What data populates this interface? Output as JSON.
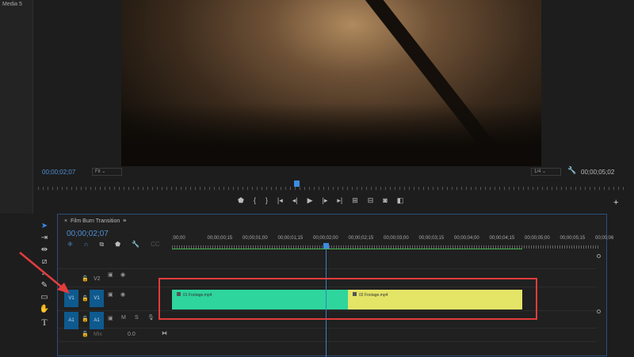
{
  "project_panel": {
    "tab_label": "Media 5"
  },
  "monitor": {
    "timecode": "00;00;02;07",
    "zoom": "Fit",
    "resolution": "1/4",
    "duration": "00;00;05;02",
    "playhead_fraction": 0.44,
    "controls": [
      "marker-icon",
      "mark-in-icon",
      "mark-out-icon",
      "go-to-in-icon",
      "step-back-icon",
      "play-icon",
      "step-forward-icon",
      "go-to-out-icon",
      "lift-icon",
      "extract-icon",
      "export-frame-icon",
      "compare-icon"
    ],
    "add_label": "+"
  },
  "tools": [
    "selection-tool",
    "track-select-tool",
    "ripple-edit-tool",
    "razor-tool",
    "slip-tool",
    "pen-tool",
    "rectangle-tool",
    "hand-tool",
    "type-tool"
  ],
  "timeline": {
    "close": "×",
    "title": "Film Burn Transition",
    "menu": "≡",
    "timecode": "00;00;02;07",
    "ruler": [
      ";00;00",
      "00;00;00;15",
      "00;00;01;00",
      "00;00;01;15",
      "00;00;02;00",
      "00;00;02;15",
      "00;00;03;00",
      "00;00;03;15",
      "00;00;04;00",
      "00;00;04;15",
      "00;00;05;00",
      "00;00;05;15",
      "00;00;06"
    ],
    "tracks": {
      "v2": "V2",
      "v1_src": "V1",
      "v1": "V1",
      "a1_src": "A1",
      "a1": "A1",
      "mute": "M",
      "solo": "S",
      "mix": "Mix",
      "mix_value": "0.0"
    },
    "clips": [
      {
        "name": "01 Footage.mp4",
        "color": "#2ed59d"
      },
      {
        "name": "02 Footage.mp4",
        "color": "#e4e467"
      }
    ]
  },
  "annotation_color": "#e23c3c"
}
